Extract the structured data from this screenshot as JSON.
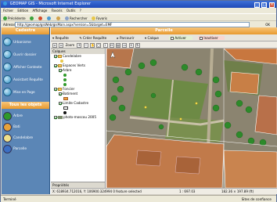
{
  "window": {
    "title": "GEOMAP GIS - Microsoft Internet Explorer",
    "controls": [
      "_",
      "□",
      "×"
    ]
  },
  "menubar": [
    "Fichier",
    "Edition",
    "Affichage",
    "Favoris",
    "Outils",
    "?"
  ],
  "toolbar": {
    "back": "Précédente",
    "search": "Rechercher",
    "favorites": "Favoris"
  },
  "address": {
    "label": "Adresse",
    "url": "http://geomap/gisWeb/gisMain.aspx?version=5&target=EMF",
    "go": "OK"
  },
  "left_panel": {
    "title": "Cadastre",
    "menu": [
      {
        "label": "Urbanisme",
        "icon": "urbanisme-icon"
      },
      {
        "label": "Ouvrir dossier",
        "icon": "folder-icon"
      },
      {
        "label": "Afficher Contexte",
        "icon": "context-icon"
      },
      {
        "label": "Assistant Requête",
        "icon": "assistant-icon"
      },
      {
        "label": "Mise en Page",
        "icon": "layout-icon"
      }
    ],
    "objects_title": "Tous les objets",
    "objects": [
      {
        "label": "Arbre",
        "color": "#2f9a2a"
      },
      {
        "label": "Bati",
        "color": "#e8a23a"
      },
      {
        "label": "Candelabre",
        "color": "#f0e08a"
      },
      {
        "label": "Parcelle",
        "color": "#3c6fc4"
      }
    ]
  },
  "main": {
    "title": "Parcelle",
    "tools": {
      "requete": "Requête",
      "creer": "Créer Requête",
      "parcourir": "Parcourir",
      "calque": "Calque",
      "activer": "Activer",
      "inactiver": "Inactiver"
    },
    "nav": {
      "zoom_label": "Zoom"
    },
    "layers_header": "Calques",
    "layers": [
      {
        "label": "Candelabre",
        "indent": 1,
        "checked": true
      },
      {
        "label": "Espaces Verts",
        "indent": 1,
        "checked": true
      },
      {
        "label": "Arbre",
        "indent": 2,
        "checked": true
      },
      {
        "label": "Foncier",
        "indent": 1,
        "checked": true
      },
      {
        "label": "Batiment",
        "indent": 2,
        "checked": true
      },
      {
        "label": "Limite Cadastre",
        "indent": 2,
        "checked": true
      },
      {
        "label": "photo-moscou 2005",
        "indent": 1,
        "checked": true
      }
    ],
    "properties_label": "Propriétés",
    "status": {
      "coords": "X: 618934.712016, Y: 106900.324994  0 feature selected",
      "scale": "1 : 697.03",
      "size": "182.36 × 197.89 (ft)"
    }
  },
  "ie_status": {
    "left": "Terminé",
    "zone": "Sites de confiance"
  }
}
